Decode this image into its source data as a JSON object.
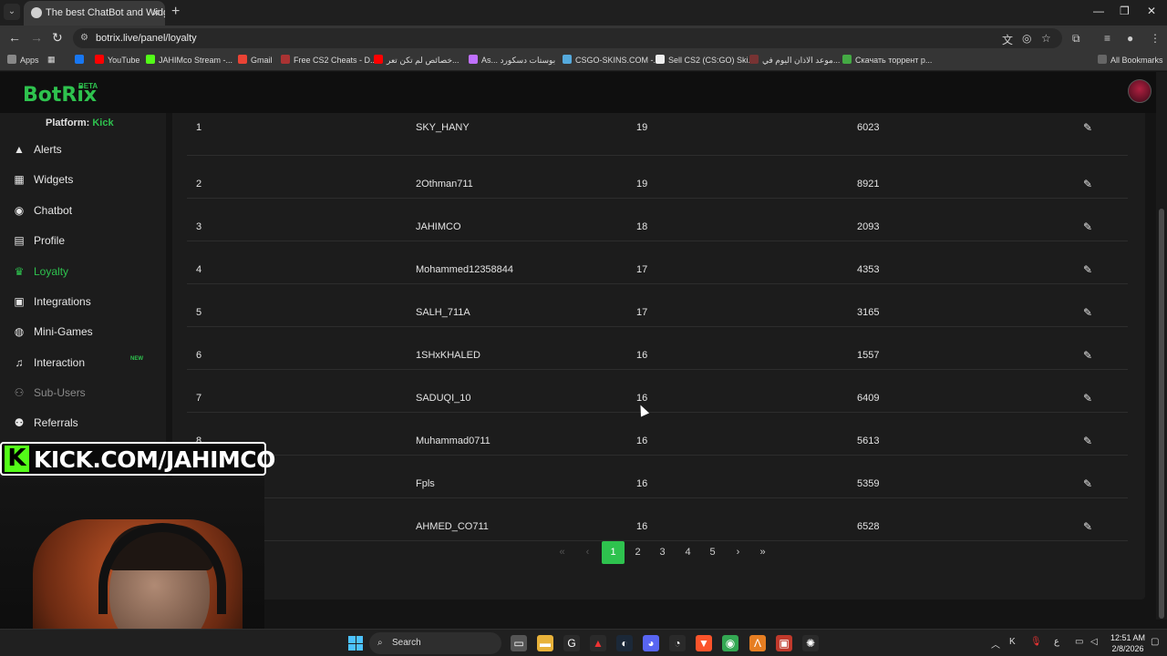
{
  "browser": {
    "tab_title": "The best ChatBot and Widgets",
    "url": "botrix.live/panel/loyalty",
    "bookmarks": [
      "Apps",
      "YouTube",
      "JAHIMco Stream -...",
      "Gmail",
      "Free CS2 Cheats - D...",
      "خصائص لم تكن تعر...",
      "As... بوستات دسكورد",
      "CSGO-SKINS.COM -...",
      "Sell CS2 (CS:GO) Ski...",
      "موعد الاذان اليوم في...",
      "Скачать торрент р..."
    ],
    "all_bookmarks": "All Bookmarks"
  },
  "app": {
    "logo": "BotRix",
    "beta": "BETA",
    "platform_label": "Platform:",
    "platform_value": "Kick"
  },
  "sidebar": {
    "items": [
      {
        "label": "Alerts",
        "icon": "alert-triangle-icon"
      },
      {
        "label": "Widgets",
        "icon": "grid-icon"
      },
      {
        "label": "Chatbot",
        "icon": "robot-icon"
      },
      {
        "label": "Profile",
        "icon": "id-card-icon"
      },
      {
        "label": "Loyalty",
        "icon": "trophy-icon"
      },
      {
        "label": "Integrations",
        "icon": "plug-icon"
      },
      {
        "label": "Mini-Games",
        "icon": "gamepad-icon"
      },
      {
        "label": "Interaction",
        "icon": "music-icon"
      },
      {
        "label": "Sub-Users",
        "icon": "users-icon"
      },
      {
        "label": "Referrals",
        "icon": "user-group-icon"
      }
    ],
    "new_badge": "NEW"
  },
  "table": {
    "rows": [
      {
        "rank": "1",
        "user": "SKY_HANY",
        "level": "19",
        "points": "6023"
      },
      {
        "rank": "2",
        "user": "2Othman711",
        "level": "19",
        "points": "8921"
      },
      {
        "rank": "3",
        "user": "JAHIMCO",
        "level": "18",
        "points": "2093"
      },
      {
        "rank": "4",
        "user": "Mohammed12358844",
        "level": "17",
        "points": "4353"
      },
      {
        "rank": "5",
        "user": "SALH_711A",
        "level": "17",
        "points": "3165"
      },
      {
        "rank": "6",
        "user": "1SHxKHALED",
        "level": "16",
        "points": "1557"
      },
      {
        "rank": "7",
        "user": "SADUQI_10",
        "level": "16",
        "points": "6409"
      },
      {
        "rank": "8",
        "user": "Muhammad0711",
        "level": "16",
        "points": "5613"
      },
      {
        "rank": "",
        "user": "Fpls",
        "level": "16",
        "points": "5359"
      },
      {
        "rank": "",
        "user": "AHMED_CO711",
        "level": "16",
        "points": "6528"
      }
    ]
  },
  "pagination": {
    "first": "«",
    "prev": "‹",
    "pages": [
      "1",
      "2",
      "3",
      "4",
      "5"
    ],
    "active_page": "1",
    "next": "›",
    "last": "»"
  },
  "overlay": {
    "kick_letter": "K",
    "kick_text": "KICK.COM/JAHIMCO"
  },
  "taskbar": {
    "search": "Search",
    "time": "12:51 AM",
    "date": "2/8/2026",
    "lang": "ع"
  },
  "colors": {
    "accent": "#2ec24e",
    "kick_green": "#53fc18"
  }
}
